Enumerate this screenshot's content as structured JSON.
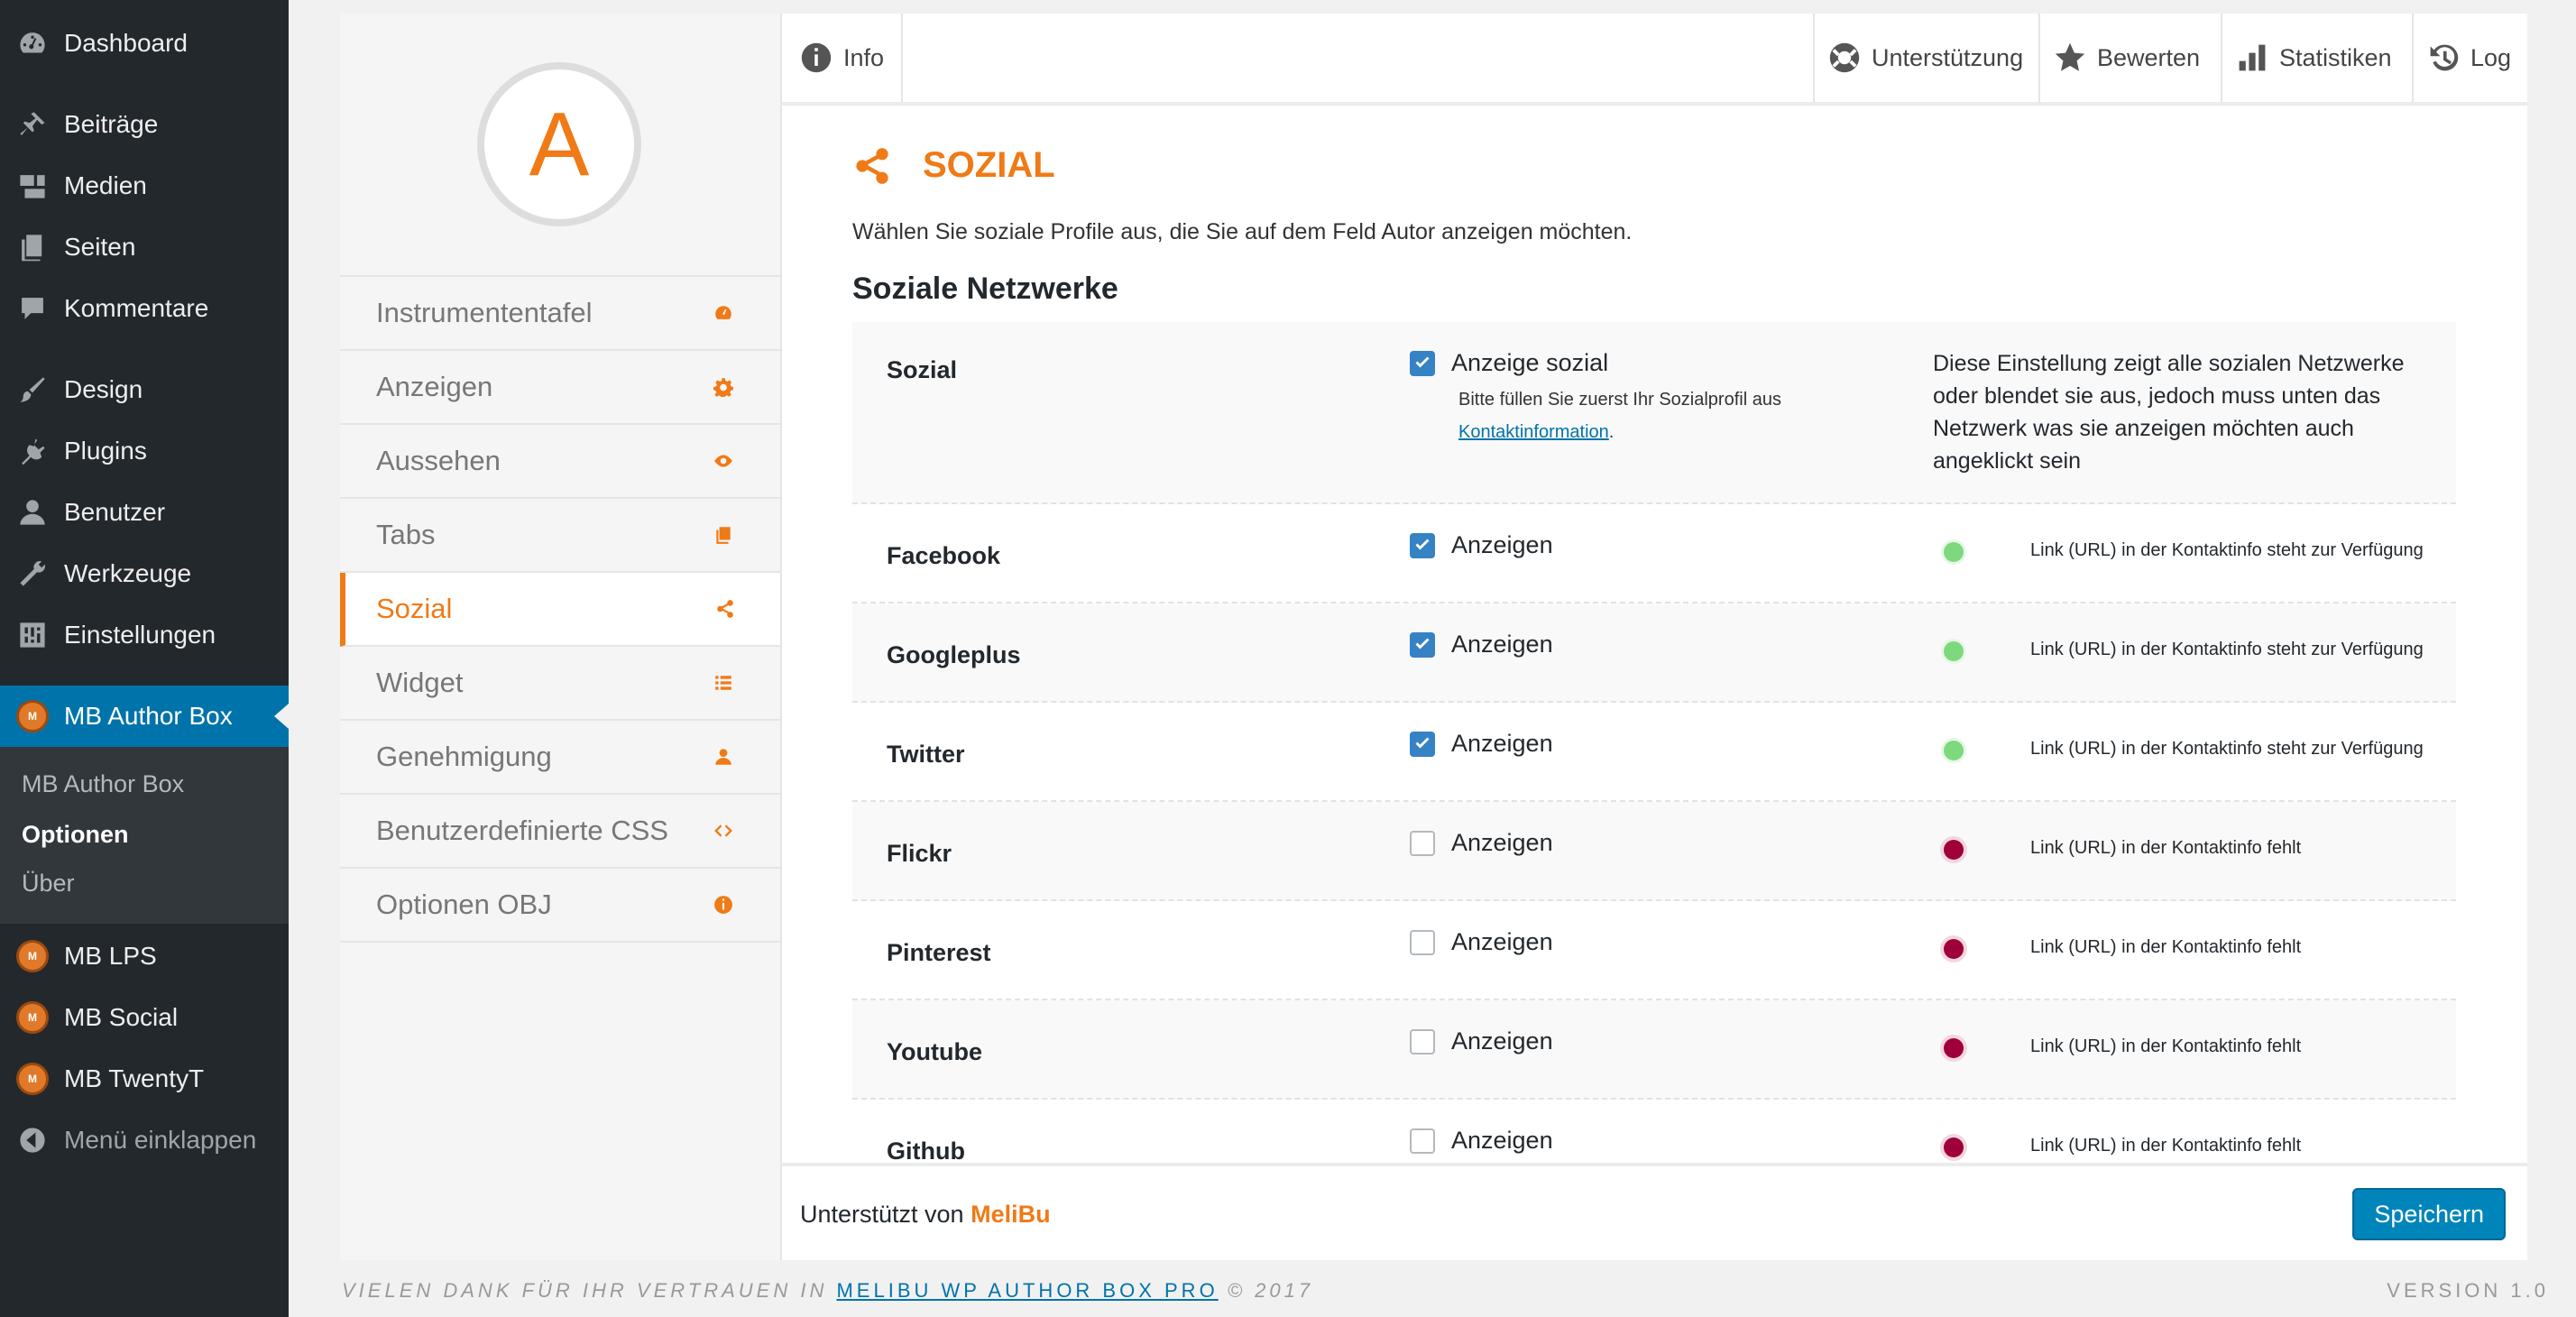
{
  "admin_menu": {
    "items": [
      {
        "label": "Dashboard",
        "icon": "dashboard-icon"
      },
      {
        "label": "Beiträge",
        "icon": "pin-icon"
      },
      {
        "label": "Medien",
        "icon": "media-icon"
      },
      {
        "label": "Seiten",
        "icon": "pages-icon"
      },
      {
        "label": "Kommentare",
        "icon": "comment-icon"
      },
      {
        "label": "Design",
        "icon": "brush-icon"
      },
      {
        "label": "Plugins",
        "icon": "plugin-icon"
      },
      {
        "label": "Benutzer",
        "icon": "user-icon"
      },
      {
        "label": "Werkzeuge",
        "icon": "wrench-icon"
      },
      {
        "label": "Einstellungen",
        "icon": "settings-icon"
      },
      {
        "label": "MB Author Box",
        "icon": "mb-logo-icon"
      },
      {
        "label": "MB LPS",
        "icon": "mb-logo-icon"
      },
      {
        "label": "MB Social",
        "icon": "mb-logo-icon"
      },
      {
        "label": "MB TwentyT",
        "icon": "mb-logo-icon"
      },
      {
        "label": "Menü einklappen",
        "icon": "collapse-icon"
      }
    ],
    "submenu": [
      "MB Author Box",
      "Optionen",
      "Über"
    ],
    "mb_logo_text": "M"
  },
  "plugin": {
    "avatar_letter": "A",
    "nav": [
      {
        "label": "Instrumententafel",
        "icon": "dashboard-icon"
      },
      {
        "label": "Anzeigen",
        "icon": "gear-icon"
      },
      {
        "label": "Aussehen",
        "icon": "eye-icon"
      },
      {
        "label": "Tabs",
        "icon": "copy-icon"
      },
      {
        "label": "Sozial",
        "icon": "share-icon"
      },
      {
        "label": "Widget",
        "icon": "list-icon"
      },
      {
        "label": "Genehmigung",
        "icon": "user-icon"
      },
      {
        "label": "Benutzerdefinierte CSS",
        "icon": "code-icon"
      },
      {
        "label": "Optionen OBJ",
        "icon": "info-icon"
      }
    ],
    "topbar": {
      "info": "Info",
      "support": "Unterstützung",
      "rate": "Bewerten",
      "stats": "Statistiken",
      "log": "Log"
    },
    "section": {
      "title": "SOZIAL",
      "description": "Wählen Sie soziale Profile aus, die Sie auf dem Feld Autor anzeigen möchten.",
      "subtitle": "Soziale Netzwerke",
      "sozial_row": {
        "label": "Sozial",
        "checkbox_label": "Anzeige sozial",
        "checked": true,
        "hint": "Bitte füllen Sie zuerst Ihr Sozialprofil aus",
        "hint_link": "Kontaktinformation",
        "hint_end": ".",
        "description": "Diese Einstellung zeigt alle sozialen Netzwerke oder blendet sie aus, jedoch muss unten das Netzwerk was sie anzeigen möchten auch angeklickt sein"
      },
      "networks": [
        {
          "label": "Facebook",
          "checkbox_label": "Anzeigen",
          "checked": true,
          "status": "ok",
          "status_text": "Link (URL) in der Kontaktinfo steht zur Verfügung"
        },
        {
          "label": "Googleplus",
          "checkbox_label": "Anzeigen",
          "checked": true,
          "status": "ok",
          "status_text": "Link (URL) in der Kontaktinfo steht zur Verfügung"
        },
        {
          "label": "Twitter",
          "checkbox_label": "Anzeigen",
          "checked": true,
          "status": "ok",
          "status_text": "Link (URL) in der Kontaktinfo steht zur Verfügung"
        },
        {
          "label": "Flickr",
          "checkbox_label": "Anzeigen",
          "checked": false,
          "status": "missing",
          "status_text": "Link (URL) in der Kontaktinfo fehlt"
        },
        {
          "label": "Pinterest",
          "checkbox_label": "Anzeigen",
          "checked": false,
          "status": "missing",
          "status_text": "Link (URL) in der Kontaktinfo fehlt"
        },
        {
          "label": "Youtube",
          "checkbox_label": "Anzeigen",
          "checked": false,
          "status": "missing",
          "status_text": "Link (URL) in der Kontaktinfo fehlt"
        },
        {
          "label": "Github",
          "checkbox_label": "Anzeigen",
          "checked": false,
          "status": "missing",
          "status_text": "Link (URL) in der Kontaktinfo fehlt"
        }
      ]
    },
    "footer": {
      "powered_prefix": "Unterstützt von",
      "powered_brand": "MeliBu",
      "save": "Speichern"
    }
  },
  "page_footer": {
    "thanks": "VIELEN DANK FÜR IHR VERTRAUEN IN",
    "link": "MELIBU WP AUTHOR BOX PRO",
    "year": "© 2017",
    "version": "VERSION 1.0"
  },
  "colors": {
    "accent": "#f07a16",
    "wp_blue": "#0073aa",
    "status_ok": "#7ed97e",
    "status_missing": "#a0003a"
  }
}
